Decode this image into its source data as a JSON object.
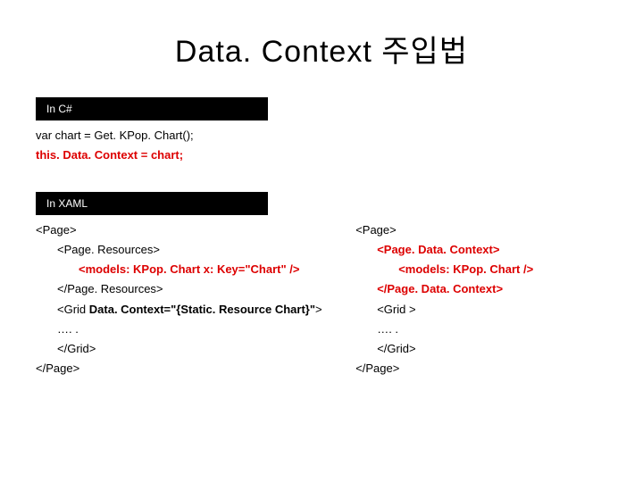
{
  "title": "Data. Context 주입법",
  "csharp": {
    "label": "In C#",
    "line1": "var chart = Get. KPop. Chart();",
    "line2": "this. Data. Context = chart;"
  },
  "xaml": {
    "label": "In XAML",
    "left": {
      "l1": "<Page>",
      "l2": "<Page. Resources>",
      "l3_a": "<models: KPop. Chart x: Key=\"Chart\" />",
      "l4": "</Page. Resources>",
      "l5_a": "<Grid ",
      "l5_b": "Data. Context=\"{Static. Resource Chart}\"",
      "l5_c": ">",
      "l6": "…. .",
      "l7": "</Grid>",
      "l8": "</Page>"
    },
    "right": {
      "l1": "<Page>",
      "l2": "<Page. Data. Context>",
      "l3": "<models: KPop. Chart />",
      "l4": "</Page. Data. Context>",
      "l5": "<Grid >",
      "l6": "…. .",
      "l7": "</Grid>",
      "l8": "</Page>"
    }
  }
}
